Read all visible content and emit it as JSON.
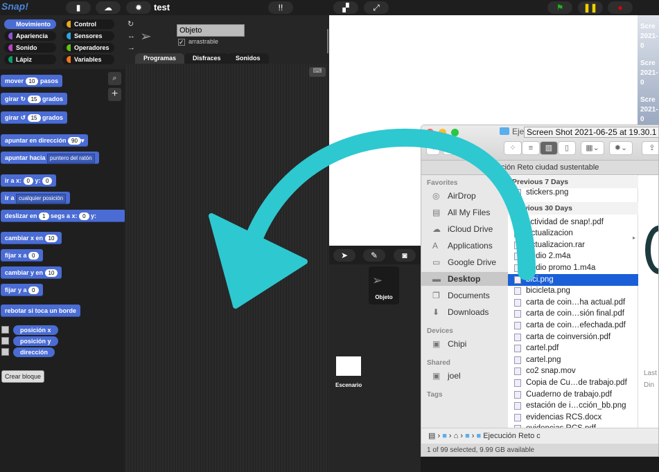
{
  "topbar": {
    "logo": "Snap!",
    "project_title": "test",
    "file_icon": "file-icon",
    "cloud_icon": "cloud-icon",
    "settings_icon": "gear-icon"
  },
  "categories": [
    {
      "label": "Movimiento",
      "color": "#4a6cd4"
    },
    {
      "label": "Control",
      "color": "#e6a822"
    },
    {
      "label": "Apariencia",
      "color": "#8a55d7"
    },
    {
      "label": "Sensores",
      "color": "#2ca5e2"
    },
    {
      "label": "Sonido",
      "color": "#bb42c3"
    },
    {
      "label": "Operadores",
      "color": "#62c213"
    },
    {
      "label": "Lápiz",
      "color": "#0e9a6c"
    },
    {
      "label": "Variables",
      "color": "#f3761d"
    }
  ],
  "blocks": {
    "mover": "mover",
    "pasos": "pasos",
    "steps": "10",
    "girar": "girar",
    "grados": "grados",
    "deg": "15",
    "apuntar_dir": "apuntar en dirección",
    "dir": "90",
    "apuntar_hacia": "apuntar hacia",
    "hacia": "puntero del ratón",
    "ir_a_x": "ir a x:",
    "y": "y:",
    "zero": "0",
    "ir_a": "ir a",
    "pos": "cualquier posición",
    "deslizar": "deslizar en",
    "one": "1",
    "segs": "segs a x:",
    "cambiar_x": "cambiar x en",
    "fijar_x": "fijar x a",
    "cambiar_y": "cambiar y en",
    "fijar_y": "fijar y a",
    "ten": "10",
    "rebotar": "rebotar si toca un borde",
    "pos_x": "posición x",
    "pos_y": "posición y",
    "direccion": "dirección",
    "crear": "Crear bloque"
  },
  "sprite": {
    "name": "Objeto",
    "draggable_label": "arrastrable",
    "draggable": true,
    "tabs": [
      "Programas",
      "Disfraces",
      "Sonidos"
    ]
  },
  "corral": {
    "sprite_name": "Objeto",
    "stage_name": "Escenario"
  },
  "desktop": {
    "labels": [
      "Scre",
      "2021-0",
      "Scre",
      "2021-0",
      "Scre",
      "2021-0"
    ],
    "preview_text": [
      "Last",
      "Din"
    ]
  },
  "finder": {
    "title": "Ejecución Reto ciudad sustentable",
    "tooltip": "Screen Shot 2021-06-25 at 19.30.1",
    "path_header": "Ejecución Reto ciudad sustentable",
    "sidebar": {
      "favorites_label": "Favorites",
      "favorites": [
        {
          "label": "AirDrop",
          "icon": "airdrop-icon",
          "g": "◎"
        },
        {
          "label": "All My Files",
          "icon": "all-files-icon",
          "g": "▤"
        },
        {
          "label": "iCloud Drive",
          "icon": "cloud-icon",
          "g": "☁"
        },
        {
          "label": "Applications",
          "icon": "applications-icon",
          "g": "A"
        },
        {
          "label": "Google Drive",
          "icon": "folder-icon",
          "g": "▭"
        },
        {
          "label": "Desktop",
          "icon": "desktop-icon",
          "g": "▬",
          "selected": true
        },
        {
          "label": "Documents",
          "icon": "documents-icon",
          "g": "❐"
        },
        {
          "label": "Downloads",
          "icon": "downloads-icon",
          "g": "⬇"
        }
      ],
      "devices_label": "Devices",
      "devices": [
        {
          "label": "Chipi",
          "icon": "disk-icon",
          "g": "▣"
        }
      ],
      "shared_label": "Shared",
      "shared": [
        {
          "label": "joel",
          "icon": "computer-icon",
          "g": "▣"
        }
      ],
      "tags_label": "Tags"
    },
    "groups": [
      {
        "label": "Previous 7 Days",
        "files": [
          "stickers.png"
        ]
      },
      {
        "label": "Previous 30 Days",
        "files": [
          "actividad de snap!.pdf",
          "Actualizacion",
          "Actualizacion.rar",
          "Audio 2.m4a",
          "Audio promo 1.m4a",
          "bici.png",
          "bicicleta.png",
          "carta de coin…ha actual.pdf",
          "carta de coin…sión final.pdf",
          "carta de coin…efechada.pdf",
          "carta de coinversión.pdf",
          "cartel.pdf",
          "cartel.png",
          "co2 snap.mov",
          "Copia de Cu…de trabajo.pdf",
          "Cuaderno de trabajo.pdf",
          "estación de i…cción_bb.png",
          "evidencias RCS.docx",
          "evidencias RCS.pdf"
        ]
      }
    ],
    "selected_file": "bici.png",
    "pathbar": "Ejecución Reto c",
    "status": "1 of 99 selected, 9.99 GB available"
  },
  "colors": {
    "arrow": "#2ec8d0",
    "selection": "#1a5fd7",
    "motion": "#4a6cd4"
  }
}
